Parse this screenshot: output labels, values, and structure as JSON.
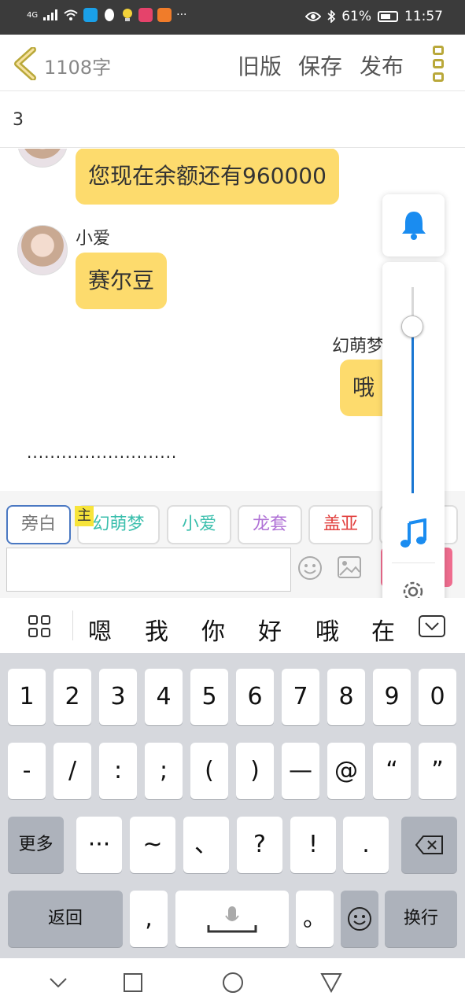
{
  "status_bar": {
    "network": "4G",
    "more": "···",
    "battery": "61%",
    "time": "11:57"
  },
  "toolbar": {
    "word_count": "1108字",
    "old_version": "旧版",
    "save": "保存",
    "publish": "发布"
  },
  "chapter_title": "3",
  "chat": {
    "messages": [
      {
        "text": "您现在余额还有960000"
      },
      {
        "sender": "小爱",
        "text": "赛尔豆"
      },
      {
        "sender": "幻萌梦",
        "text": "哦"
      }
    ],
    "ellipsis": "··························"
  },
  "characters": {
    "main_badge": "主",
    "chips": [
      "旁白",
      "幻萌梦",
      "小爱",
      "龙套",
      "盖亚"
    ],
    "colors": [
      "#777777",
      "#3bbfad",
      "#3bbfad",
      "#b072d6",
      "#e2413f"
    ]
  },
  "volume": {
    "level": 0.81
  },
  "suggestions": [
    "嗯",
    "我",
    "你",
    "好",
    "哦",
    "在"
  ],
  "keyboard": {
    "row1": [
      "1",
      "2",
      "3",
      "4",
      "5",
      "6",
      "7",
      "8",
      "9",
      "0"
    ],
    "row2": [
      "-",
      "/",
      ":",
      ";",
      "(",
      ")",
      "—",
      "@",
      "“",
      "”"
    ],
    "more": "更多",
    "row3": [
      "···",
      "~",
      "、",
      "?",
      "!",
      "."
    ],
    "back": "返回",
    "comma": ",",
    "period": "。",
    "enter": "换行"
  }
}
